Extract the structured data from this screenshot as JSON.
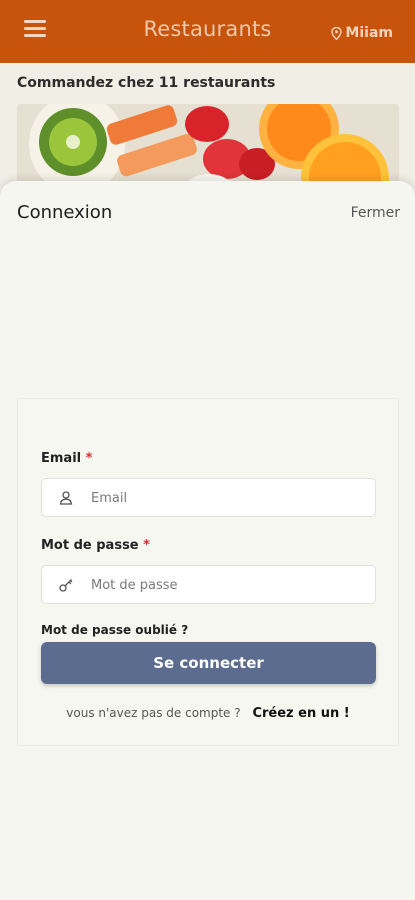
{
  "header": {
    "title": "Restaurants",
    "brand": "Miiam"
  },
  "page": {
    "subtitle": "Commandez chez 11 restaurants"
  },
  "sheet": {
    "title": "Connexion",
    "close_label": "Fermer"
  },
  "form": {
    "email_label": "Email",
    "email_placeholder": "Email",
    "email_value": "",
    "password_label": "Mot de passe",
    "password_placeholder": "Mot de passe",
    "password_value": "",
    "required_mark": "*",
    "forgot_label": "Mot de passe oublié ?",
    "submit_label": "Se connecter",
    "signup_question": "vous n'avez pas de compte ?",
    "signup_link": "Créez en un !"
  },
  "colors": {
    "header_bg": "#c8530b",
    "button_bg": "#5b6c8f",
    "required": "#d32f2f"
  },
  "icons": {
    "menu": "hamburger-icon",
    "brand": "map-pin-icon",
    "email_field": "user-icon",
    "password_field": "key-icon"
  }
}
